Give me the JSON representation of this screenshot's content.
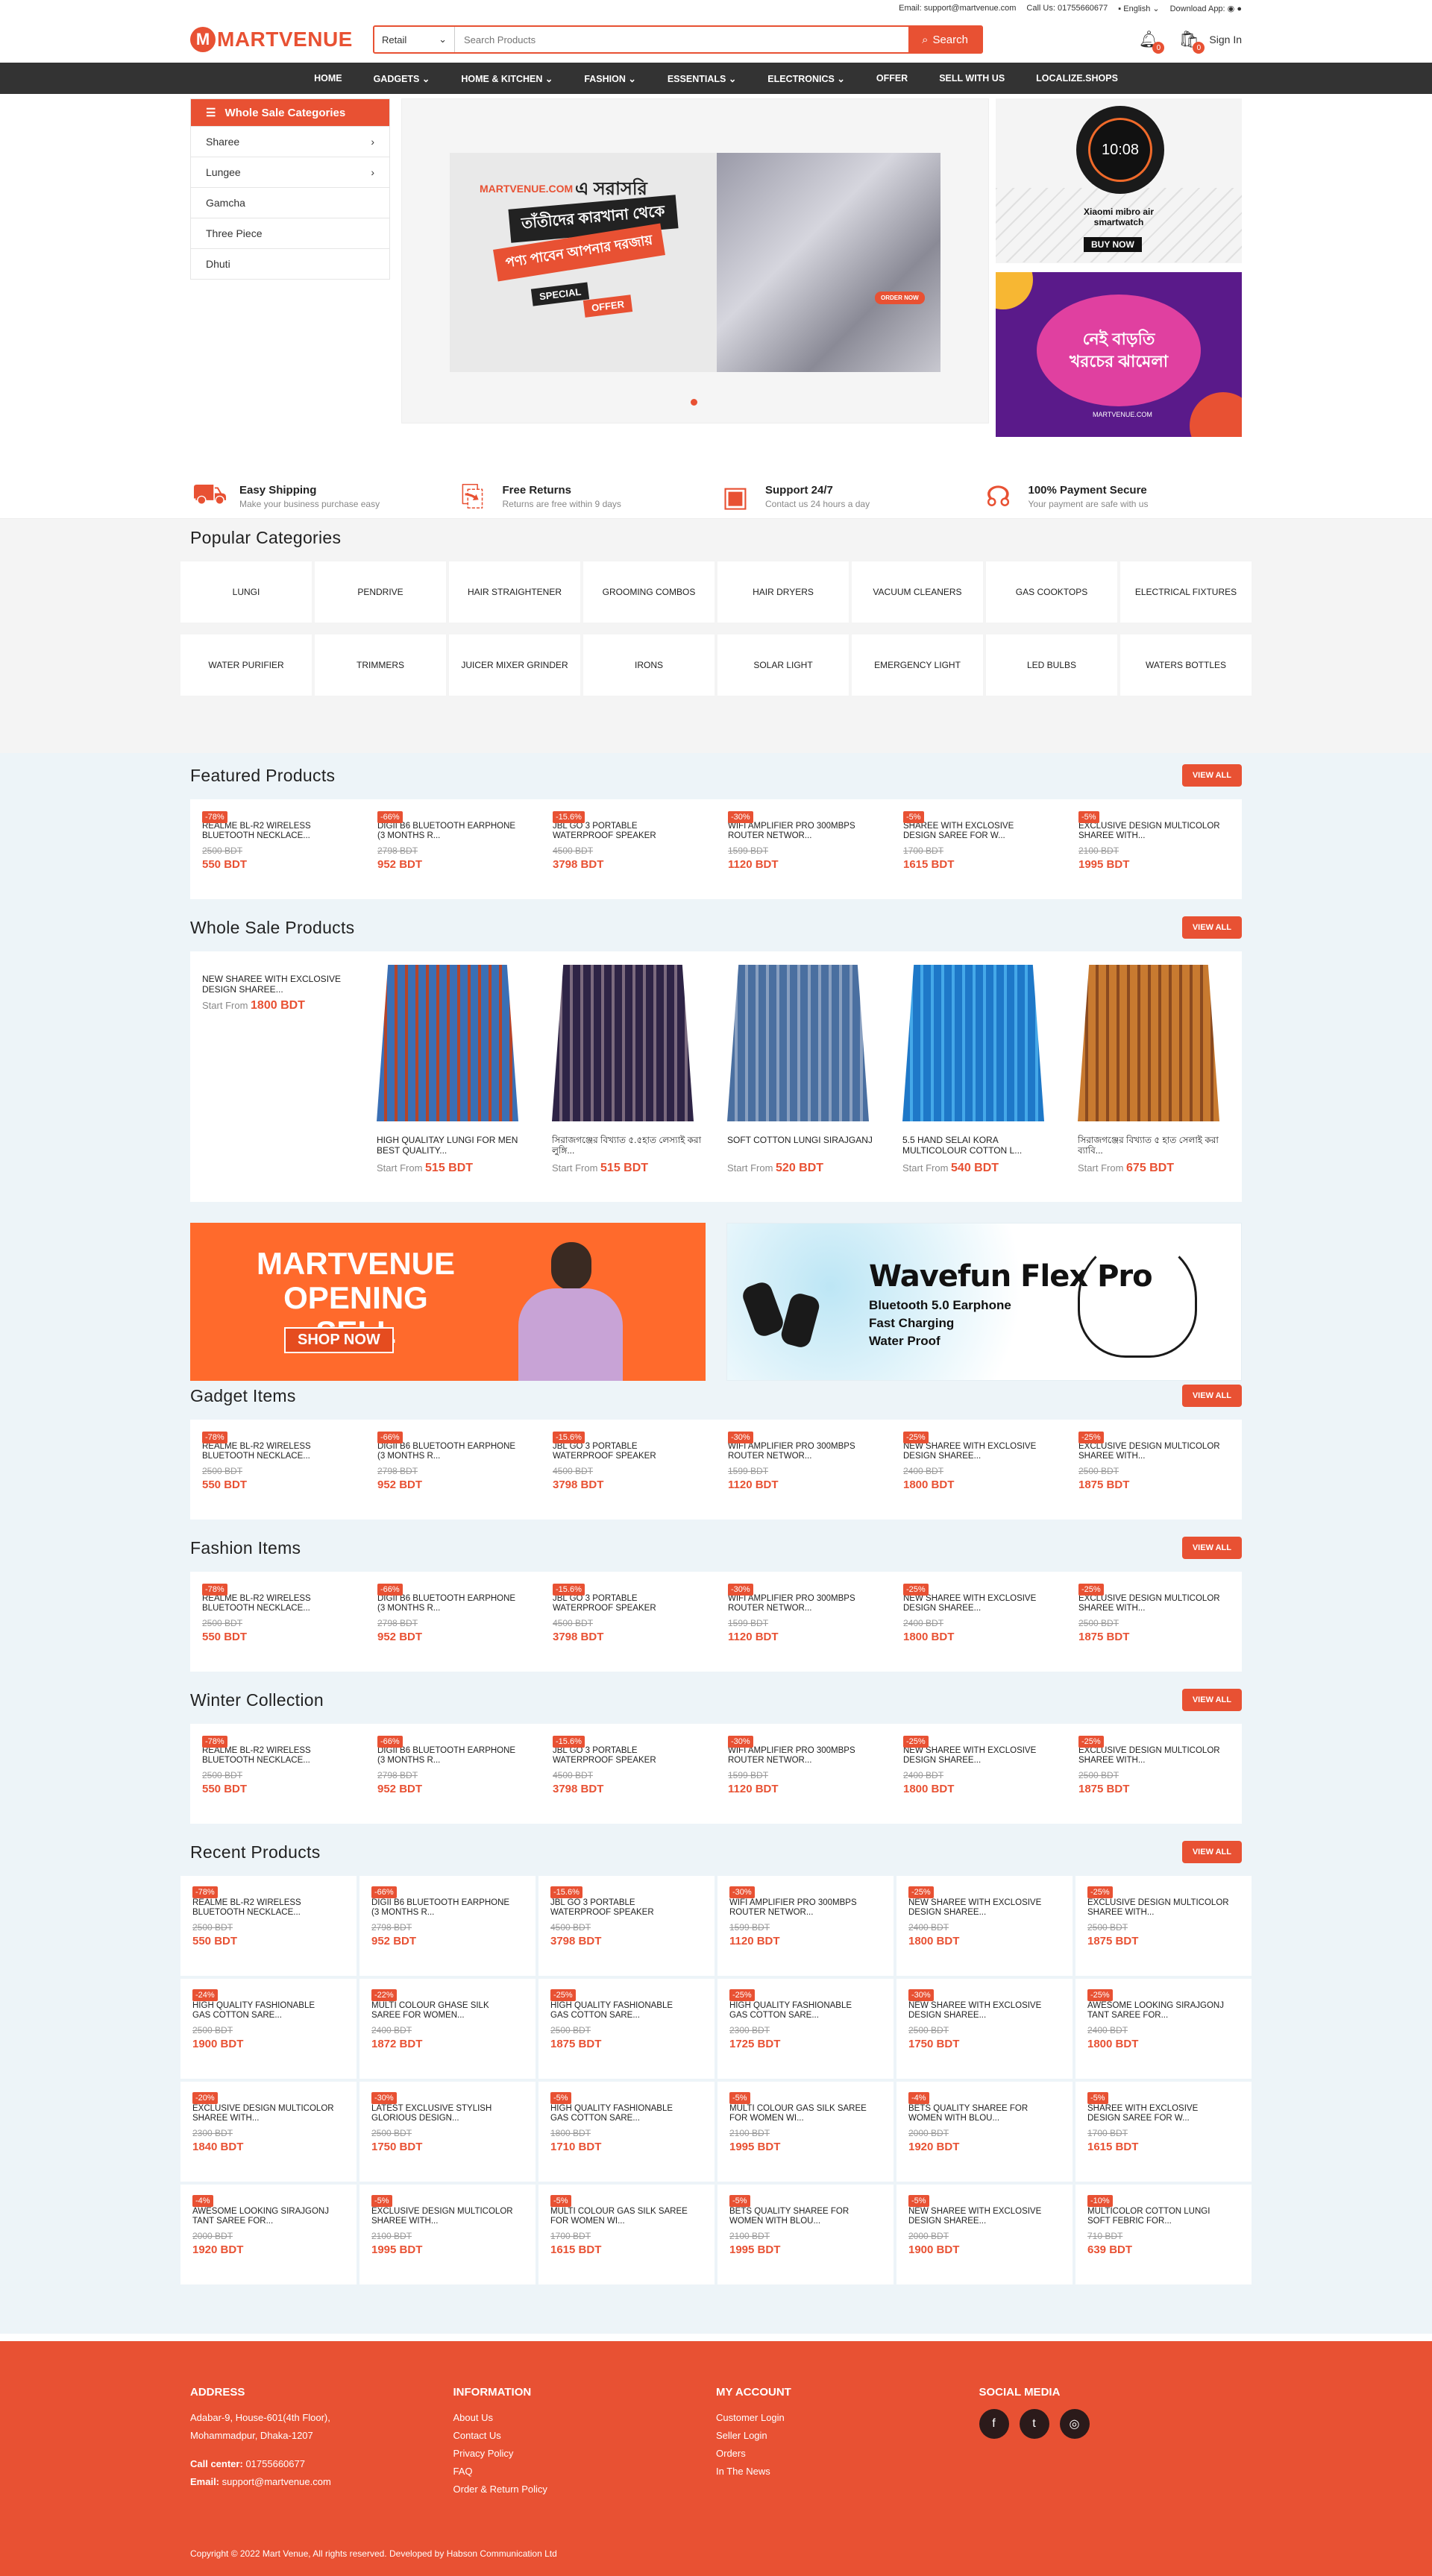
{
  "topbar": {
    "email": "Email: support@martvenue.com",
    "call": "Call Us: 01755660677",
    "lang": "English",
    "download": "Download App:"
  },
  "header": {
    "logo_mark": "M",
    "logo_text": "MARTVENUE",
    "search_category": "Retail",
    "search_placeholder": "Search Products",
    "search_button": "Search",
    "notif_count": "0",
    "cart_count": "0",
    "signin": "Sign In"
  },
  "nav": [
    "HOME",
    "GADGETS",
    "HOME & KITCHEN",
    "FASHION",
    "ESSENTIALS",
    "ELECTRONICS",
    "OFFER",
    "SELL WITH US",
    "LOCALIZE.SHOPS"
  ],
  "wholesale_menu": {
    "title": "Whole Sale Categories",
    "items": [
      "Sharee",
      "Lungee",
      "Gamcha",
      "Three Piece",
      "Dhuti"
    ]
  },
  "hero": {
    "brand": "MARTVENUE.COM",
    "line1": "এ সরাসরি",
    "line2": "তাঁতীদের কারখানা থেকে",
    "line3": "পণ্য পাবেন আপনার দরজায়",
    "special": "SPECIAL",
    "offer": "OFFER",
    "order": "ORDER NOW"
  },
  "side_banner1": {
    "time": "10:08",
    "title": "Xiaomi mibro air smartwatch",
    "cta": "BUY NOW"
  },
  "side_banner2": {
    "text": "নেই বাড়তি খরচের ঝামেলা",
    "brand": "MARTVENUE.COM"
  },
  "features": [
    {
      "title": "Easy Shipping",
      "desc": "Make your business purchase easy"
    },
    {
      "title": "Free Returns",
      "desc": "Returns are free within 9 days"
    },
    {
      "title": "Support 24/7",
      "desc": "Contact us 24 hours a day"
    },
    {
      "title": "100% Payment Secure",
      "desc": "Your payment are safe with us"
    }
  ],
  "popular": {
    "title": "Popular Categories",
    "row1": [
      "LUNGI",
      "PENDRIVE",
      "HAIR STRAIGHTENER",
      "GROOMING COMBOS",
      "HAIR DRYERS",
      "VACUUM CLEANERS",
      "GAS COOKTOPS",
      "ELECTRICAL FIXTURES"
    ],
    "row2": [
      "WATER PURIFIER",
      "TRIMMERS",
      "JUICER MIXER GRINDER",
      "IRONS",
      "SOLAR LIGHT",
      "EMERGENCY LIGHT",
      "LED BULBS",
      "WATERS BOTTLES"
    ]
  },
  "view_all": "VIEW ALL",
  "featured": {
    "title": "Featured Products",
    "items": [
      {
        "badge": "-78%",
        "name": "REALME BL-R2 WIRELESS BLUETOOTH NECKLACE...",
        "old": "2500 BDT",
        "new": "550 BDT"
      },
      {
        "badge": "-66%",
        "name": "DIGII B6 BLUETOOTH EARPHONE (3 MONTHS R...",
        "old": "2798 BDT",
        "new": "952 BDT"
      },
      {
        "badge": "-15.6%",
        "name": "JBL GO 3 PORTABLE WATERPROOF SPEAKER",
        "old": "4500 BDT",
        "new": "3798 BDT"
      },
      {
        "badge": "-30%",
        "name": "WIFI AMPLIFIER PRO 300MBPS ROUTER NETWOR...",
        "old": "1599 BDT",
        "new": "1120 BDT"
      },
      {
        "badge": "-5%",
        "name": "SHAREE WITH EXCLOSIVE DESIGN SAREE FOR W...",
        "old": "1700 BDT",
        "new": "1615 BDT"
      },
      {
        "badge": "-5%",
        "name": "EXCLUSIVE DESIGN MULTICOLOR SHAREE WITH...",
        "old": "2100 BDT",
        "new": "1995 BDT"
      }
    ]
  },
  "wholesale": {
    "title": "Whole Sale Products",
    "lead_name": "NEW SHAREE WITH EXCLOSIVE DESIGN SHAREE...",
    "start_from": "Start From",
    "lead_price": "1800 BDT",
    "items": [
      {
        "name": "HIGH QUALITAY LUNGI FOR MEN BEST QUALITY...",
        "price": "515 BDT"
      },
      {
        "name": "সিরাজগঞ্জের বিখ্যাত ৫.৫হাত লেস্যাই করা লুঙ্গি...",
        "price": "515 BDT"
      },
      {
        "name": "SOFT COTTON LUNGI SIRAJGANJ",
        "price": "520 BDT"
      },
      {
        "name": "5.5 HAND SELAI KORA MULTICOLOUR COTTON L...",
        "price": "540 BDT"
      },
      {
        "name": "সিরাজগঞ্জের বিখ্যাত ৫ হাত সেলাই করা ব্যাবি...",
        "price": "675 BDT"
      }
    ]
  },
  "promo1": {
    "line1": "MARTVENUE",
    "line2": "OPENING SELL",
    "cta": "SHOP NOW"
  },
  "promo2": {
    "title": "Wavefun Flex Pro",
    "l1": "Bluetooth 5.0 Earphone",
    "l2": "Fast Charging",
    "l3": "Water Proof"
  },
  "gadget": {
    "title": "Gadget Items",
    "items": [
      {
        "badge": "-78%",
        "name": "REALME BL-R2 WIRELESS BLUETOOTH NECKLACE...",
        "old": "2500 BDT",
        "new": "550 BDT"
      },
      {
        "badge": "-66%",
        "name": "DIGII B6 BLUETOOTH EARPHONE (3 MONTHS R...",
        "old": "2798 BDT",
        "new": "952 BDT"
      },
      {
        "badge": "-15.6%",
        "name": "JBL GO 3 PORTABLE WATERPROOF SPEAKER",
        "old": "4500 BDT",
        "new": "3798 BDT"
      },
      {
        "badge": "-30%",
        "name": "WIFI AMPLIFIER PRO 300MBPS ROUTER NETWOR...",
        "old": "1599 BDT",
        "new": "1120 BDT"
      },
      {
        "badge": "-25%",
        "name": "NEW SHAREE WITH EXCLOSIVE DESIGN SHAREE...",
        "old": "2400 BDT",
        "new": "1800 BDT"
      },
      {
        "badge": "-25%",
        "name": "EXCLUSIVE DESIGN MULTICOLOR SHAREE WITH...",
        "old": "2500 BDT",
        "new": "1875 BDT"
      }
    ]
  },
  "fashion": {
    "title": "Fashion Items",
    "items": [
      {
        "badge": "-78%",
        "name": "REALME BL-R2 WIRELESS BLUETOOTH NECKLACE...",
        "old": "2500 BDT",
        "new": "550 BDT"
      },
      {
        "badge": "-66%",
        "name": "DIGII B6 BLUETOOTH EARPHONE (3 MONTHS R...",
        "old": "2798 BDT",
        "new": "952 BDT"
      },
      {
        "badge": "-15.6%",
        "name": "JBL GO 3 PORTABLE WATERPROOF SPEAKER",
        "old": "4500 BDT",
        "new": "3798 BDT"
      },
      {
        "badge": "-30%",
        "name": "WIFI AMPLIFIER PRO 300MBPS ROUTER NETWOR...",
        "old": "1599 BDT",
        "new": "1120 BDT"
      },
      {
        "badge": "-25%",
        "name": "NEW SHAREE WITH EXCLOSIVE DESIGN SHAREE...",
        "old": "2400 BDT",
        "new": "1800 BDT"
      },
      {
        "badge": "-25%",
        "name": "EXCLUSIVE DESIGN MULTICOLOR SHAREE WITH...",
        "old": "2500 BDT",
        "new": "1875 BDT"
      }
    ]
  },
  "winter": {
    "title": "Winter Collection",
    "items": [
      {
        "badge": "-78%",
        "name": "REALME BL-R2 WIRELESS BLUETOOTH NECKLACE...",
        "old": "2500 BDT",
        "new": "550 BDT"
      },
      {
        "badge": "-66%",
        "name": "DIGII B6 BLUETOOTH EARPHONE (3 MONTHS R...",
        "old": "2798 BDT",
        "new": "952 BDT"
      },
      {
        "badge": "-15.6%",
        "name": "JBL GO 3 PORTABLE WATERPROOF SPEAKER",
        "old": "4500 BDT",
        "new": "3798 BDT"
      },
      {
        "badge": "-30%",
        "name": "WIFI AMPLIFIER PRO 300MBPS ROUTER NETWOR...",
        "old": "1599 BDT",
        "new": "1120 BDT"
      },
      {
        "badge": "-25%",
        "name": "NEW SHAREE WITH EXCLOSIVE DESIGN SHAREE...",
        "old": "2400 BDT",
        "new": "1800 BDT"
      },
      {
        "badge": "-25%",
        "name": "EXCLUSIVE DESIGN MULTICOLOR SHAREE WITH...",
        "old": "2500 BDT",
        "new": "1875 BDT"
      }
    ]
  },
  "recent": {
    "title": "Recent Products",
    "items": [
      {
        "badge": "-78%",
        "name": "REALME BL-R2 WIRELESS BLUETOOTH NECKLACE...",
        "old": "2500 BDT",
        "new": "550 BDT"
      },
      {
        "badge": "-66%",
        "name": "DIGII B6 BLUETOOTH EARPHONE (3 MONTHS R...",
        "old": "2798 BDT",
        "new": "952 BDT"
      },
      {
        "badge": "-15.6%",
        "name": "JBL GO 3 PORTABLE WATERPROOF SPEAKER",
        "old": "4500 BDT",
        "new": "3798 BDT"
      },
      {
        "badge": "-30%",
        "name": "WIFI AMPLIFIER PRO 300MBPS ROUTER NETWOR...",
        "old": "1599 BDT",
        "new": "1120 BDT"
      },
      {
        "badge": "-25%",
        "name": "NEW SHAREE WITH EXCLOSIVE DESIGN SHAREE...",
        "old": "2400 BDT",
        "new": "1800 BDT"
      },
      {
        "badge": "-25%",
        "name": "EXCLUSIVE DESIGN MULTICOLOR SHAREE WITH...",
        "old": "2500 BDT",
        "new": "1875 BDT"
      },
      {
        "badge": "-24%",
        "name": "HIGH QUALITY FASHIONABLE GAS COTTON SARE...",
        "old": "2500 BDT",
        "new": "1900 BDT"
      },
      {
        "badge": "-22%",
        "name": "MULTI COLOUR GHASE SILK SAREE FOR WOMEN...",
        "old": "2400 BDT",
        "new": "1872 BDT"
      },
      {
        "badge": "-25%",
        "name": "HIGH QUALITY FASHIONABLE GAS COTTON SARE...",
        "old": "2500 BDT",
        "new": "1875 BDT"
      },
      {
        "badge": "-25%",
        "name": "HIGH QUALITY FASHIONABLE GAS COTTON SARE...",
        "old": "2300 BDT",
        "new": "1725 BDT"
      },
      {
        "badge": "-30%",
        "name": "NEW SHAREE WITH EXCLOSIVE DESIGN SHAREE...",
        "old": "2500 BDT",
        "new": "1750 BDT"
      },
      {
        "badge": "-25%",
        "name": "AWESOME LOOKING SIRAJGONJ TANT SAREE FOR...",
        "old": "2400 BDT",
        "new": "1800 BDT"
      },
      {
        "badge": "-20%",
        "name": "EXCLUSIVE DESIGN MULTICOLOR SHAREE WITH...",
        "old": "2300 BDT",
        "new": "1840 BDT"
      },
      {
        "badge": "-30%",
        "name": "LATEST EXCLUSIVE STYLISH GLORIOUS DESIGN...",
        "old": "2500 BDT",
        "new": "1750 BDT"
      },
      {
        "badge": "-5%",
        "name": "HIGH QUALITY FASHIONABLE GAS COTTON SARE...",
        "old": "1800 BDT",
        "new": "1710 BDT"
      },
      {
        "badge": "-5%",
        "name": "MULTI COLOUR GAS SILK SAREE FOR WOMEN WI...",
        "old": "2100 BDT",
        "new": "1995 BDT"
      },
      {
        "badge": "-4%",
        "name": "BETS QUALITY SHAREE FOR WOMEN WITH BLOU...",
        "old": "2000 BDT",
        "new": "1920 BDT"
      },
      {
        "badge": "-5%",
        "name": "SHAREE WITH EXCLOSIVE DESIGN SAREE FOR W...",
        "old": "1700 BDT",
        "new": "1615 BDT"
      },
      {
        "badge": "-4%",
        "name": "AWESOME LOOKING SIRAJGONJ TANT SAREE FOR...",
        "old": "2000 BDT",
        "new": "1920 BDT"
      },
      {
        "badge": "-5%",
        "name": "EXCLUSIVE DESIGN MULTICOLOR SHAREE WITH...",
        "old": "2100 BDT",
        "new": "1995 BDT"
      },
      {
        "badge": "-5%",
        "name": "MULTI COLOUR GAS SILK SAREE FOR WOMEN WI...",
        "old": "1700 BDT",
        "new": "1615 BDT"
      },
      {
        "badge": "-5%",
        "name": "BETS QUALITY SHAREE FOR WOMEN WITH BLOU...",
        "old": "2100 BDT",
        "new": "1995 BDT"
      },
      {
        "badge": "-5%",
        "name": "NEW SHAREE WITH EXCLOSIVE DESIGN SHAREE...",
        "old": "2000 BDT",
        "new": "1900 BDT"
      },
      {
        "badge": "-10%",
        "name": "MULTICOLOR COTTON LUNGI SOFT FEBRIC FOR...",
        "old": "710 BDT",
        "new": "639 BDT"
      }
    ]
  },
  "footer": {
    "address_title": "ADDRESS",
    "address1": "Adabar-9, House-601(4th Floor),",
    "address2": "Mohammadpur, Dhaka-1207",
    "call_label": "Call center:",
    "call": "01755660677",
    "email_label": "Email:",
    "email": "support@martvenue.com",
    "info_title": "INFORMATION",
    "info": [
      "About Us",
      "Contact Us",
      "Privacy Policy",
      "FAQ",
      "Order & Return Policy"
    ],
    "account_title": "MY ACCOUNT",
    "account": [
      "Customer Login",
      "Seller Login",
      "Orders",
      "In The News"
    ],
    "social_title": "SOCIAL MEDIA",
    "social": [
      "f",
      "t",
      "◎"
    ],
    "copyright": "Copyright © 2022 Mart Venue, All rights reserved. Developed by Habson Communication Ltd"
  },
  "colors": {
    "accent": "#e85133",
    "nav": "#333333",
    "section_bg": "#edf4f8"
  }
}
